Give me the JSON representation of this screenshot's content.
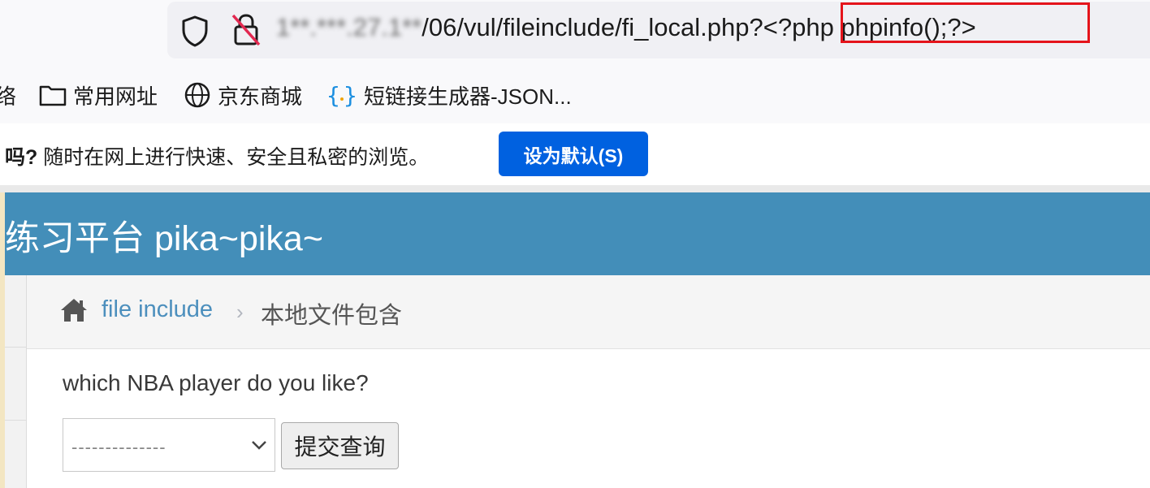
{
  "browser": {
    "url_host": "1**.***.27.1**",
    "url_path": "/06/vul/fileinclude/fi_local.php?",
    "url_query": "<?php phpinfo();?>"
  },
  "bookmarks": {
    "partial": "络",
    "items": [
      {
        "label": "常用网址",
        "icon": "folder-icon"
      },
      {
        "label": "京东商城",
        "icon": "globe-icon"
      },
      {
        "label": "短链接生成器-JSON...",
        "icon": "braces-icon"
      }
    ]
  },
  "notification": {
    "question": "吗?",
    "text": " 随时在网上进行快速、安全且私密的浏览。",
    "button_label": "设为默认(S)"
  },
  "site": {
    "title": "练习平台 pika~pika~",
    "header_color": "#438eb9"
  },
  "breadcrumb": {
    "link": "file include",
    "separator": "›",
    "current": "本地文件包含"
  },
  "form": {
    "question": "which NBA player do you like?",
    "select_value": "--------------",
    "submit_label": "提交查询"
  }
}
